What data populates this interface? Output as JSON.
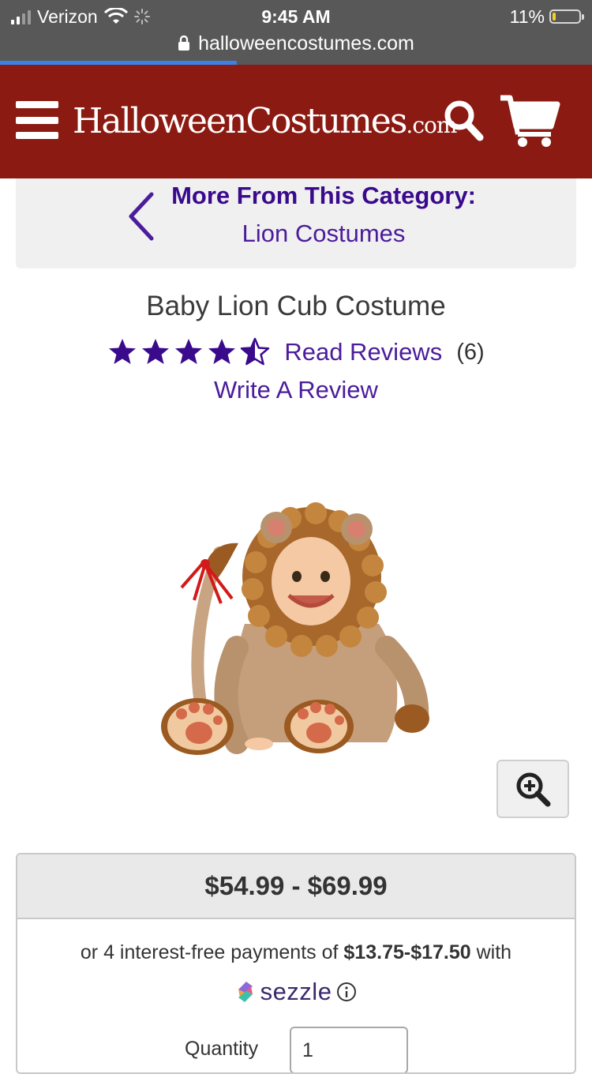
{
  "status_bar": {
    "carrier": "Verizon",
    "time": "9:45 AM",
    "battery_percent": "11%",
    "battery_level": 0.11,
    "url": "halloweencostumes.com",
    "load_progress": 0.4
  },
  "header": {
    "logo_main": "HalloweenCostumes",
    "logo_tld": ".com",
    "colors": {
      "bar": "#8b1a12"
    }
  },
  "category": {
    "heading": "More From This Category:",
    "link": "Lion Costumes"
  },
  "product": {
    "title": "Baby Lion Cub Costume",
    "rating": 4.5,
    "read_reviews_label": "Read Reviews",
    "review_count": "(6)",
    "write_review_label": "Write A Review",
    "image_icon": "lion-cub-costume-photo"
  },
  "price": {
    "range": "$54.99 - $69.99",
    "sezzle_prefix": "or 4 interest-free payments of",
    "sezzle_amount": "$13.75-$17.50",
    "sezzle_suffix": "with",
    "sezzle_brand": "sezzle",
    "quantity_label": "Quantity",
    "quantity_value": "1"
  },
  "colors": {
    "link": "#4b1c9c",
    "star": "#3a0a8c",
    "status_bar": "#585858",
    "progress": "#3b82e8"
  }
}
